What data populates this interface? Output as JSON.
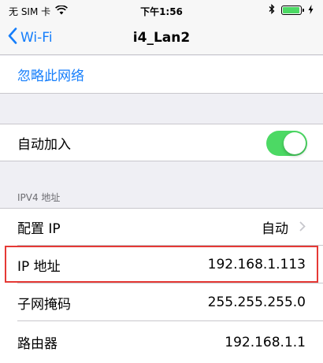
{
  "status_bar": {
    "carrier": "无 SIM 卡",
    "time": "下午1:56",
    "battery_level": 0.95
  },
  "nav": {
    "back_label": "Wi-Fi",
    "title": "i4_Lan2"
  },
  "forget_network": "忽略此网络",
  "auto_join": {
    "label": "自动加入",
    "enabled": true
  },
  "ipv4": {
    "header": "IPV4 地址",
    "configure_ip_label": "配置 IP",
    "configure_ip_value": "自动",
    "ip_address_label": "IP 地址",
    "ip_address_value": "192.168.1.113",
    "subnet_label": "子网掩码",
    "subnet_value": "255.255.255.0",
    "router_label": "路由器",
    "router_value": "192.168.1.1"
  },
  "colors": {
    "accent": "#157efb",
    "toggle_on": "#4cd964",
    "highlight": "#e53935"
  }
}
